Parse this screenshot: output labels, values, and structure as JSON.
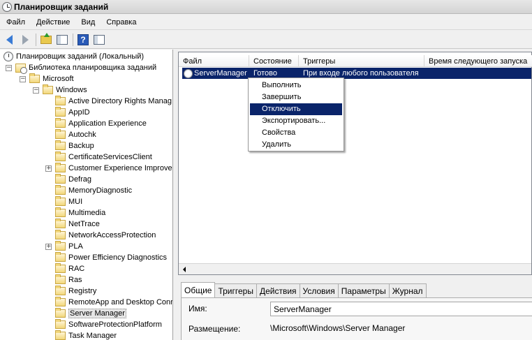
{
  "window": {
    "title": "Планировщик заданий"
  },
  "menu": [
    "Файл",
    "Действие",
    "Вид",
    "Справка"
  ],
  "tree": {
    "root": "Планировщик заданий (Локальный)",
    "library": "Библиотека планировщика заданий",
    "microsoft": "Microsoft",
    "windows": "Windows",
    "folders": [
      "Active Directory Rights Manag",
      "AppID",
      "Application Experience",
      "Autochk",
      "Backup",
      "CertificateServicesClient",
      "Customer Experience Improve",
      "Defrag",
      "MemoryDiagnostic",
      "MUI",
      "Multimedia",
      "NetTrace",
      "NetworkAccessProtection",
      "PLA",
      "Power Efficiency Diagnostics",
      "RAC",
      "Ras",
      "Registry",
      "RemoteApp and Desktop Conr",
      "Server Manager",
      "SoftwareProtectionPlatform",
      "Task Manager"
    ],
    "selected": "Server Manager"
  },
  "list": {
    "columns": [
      "Файл",
      "Состояние",
      "Триггеры",
      "Время следующего запуска"
    ],
    "rows": [
      {
        "name": "ServerManager",
        "status": "Готово",
        "trigger": "При входе любого пользователя",
        "next": ""
      }
    ]
  },
  "context_menu": {
    "items": [
      "Выполнить",
      "Завершить",
      "Отключить",
      "Экспортировать...",
      "Свойства",
      "Удалить"
    ],
    "highlighted": "Отключить"
  },
  "details": {
    "tabs": [
      "Общие",
      "Триггеры",
      "Действия",
      "Условия",
      "Параметры",
      "Журнал"
    ],
    "name_label": "Имя:",
    "name_value": "ServerManager",
    "location_label": "Размещение:",
    "location_value": "\\Microsoft\\Windows\\Server Manager"
  },
  "colors": {
    "selection": "#0a246a",
    "back_arrow": "#3a7bd5"
  }
}
